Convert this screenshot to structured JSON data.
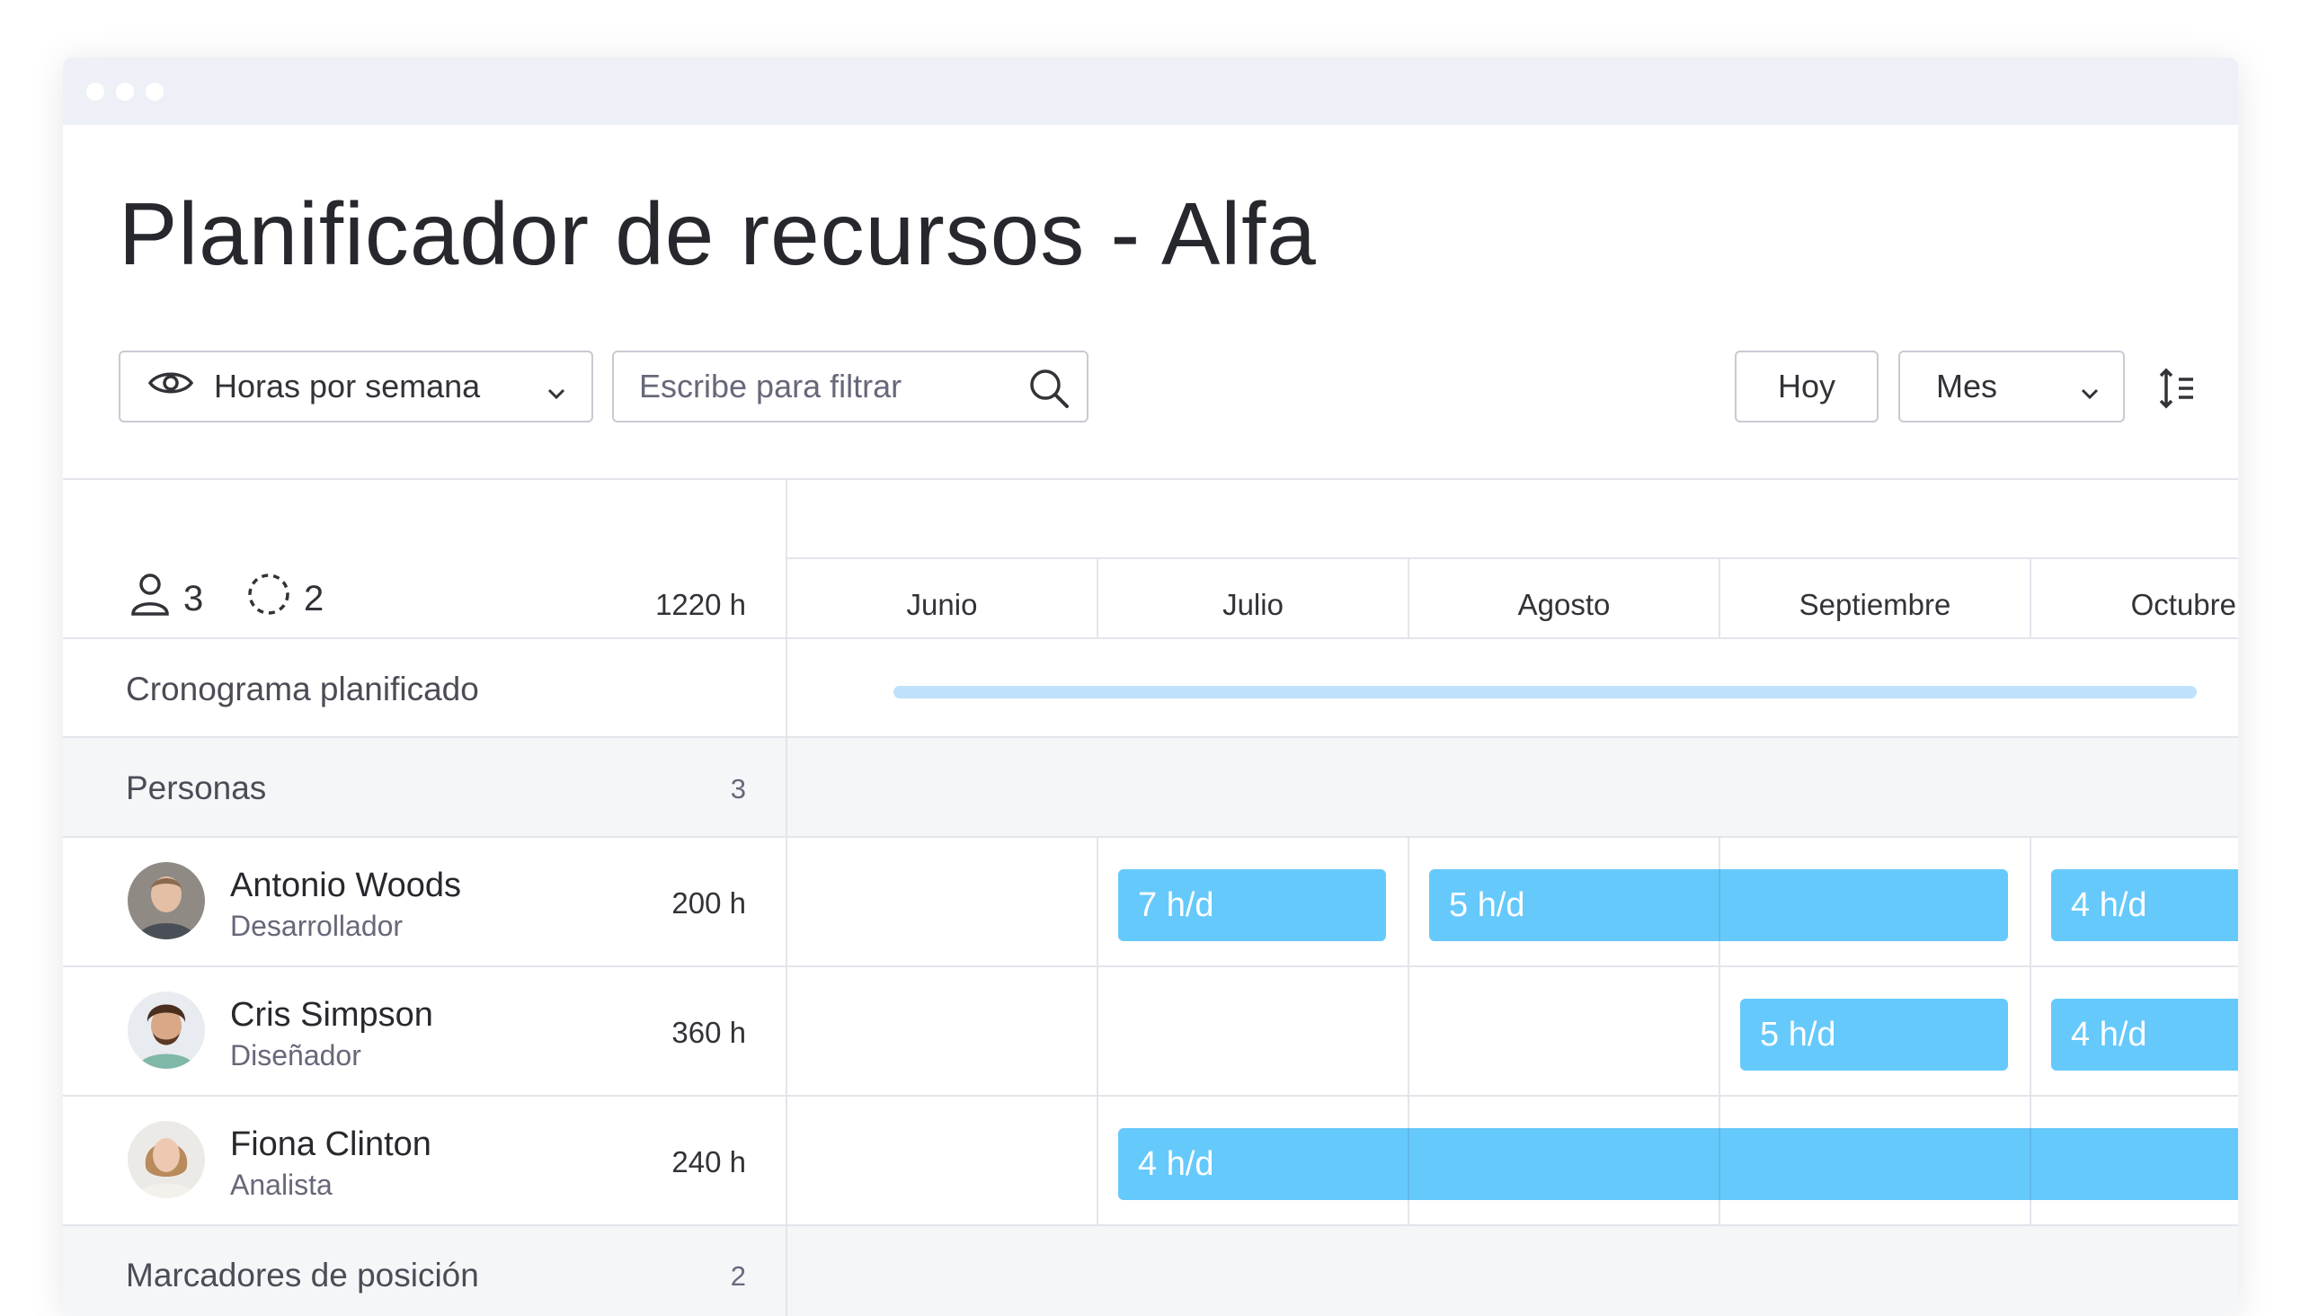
{
  "page": {
    "title": "Planificador de recursos - Alfa"
  },
  "toolbar": {
    "view_select": "Horas por semana",
    "filter_placeholder": "Escribe para filtrar",
    "today_label": "Hoy",
    "range_select": "Mes"
  },
  "summary": {
    "people_count": "3",
    "placeholder_count": "2",
    "total_hours": "1220 h"
  },
  "months": [
    "Junio",
    "Julio",
    "Agosto",
    "Septiembre",
    "Octubre"
  ],
  "schedule": {
    "label": "Cronograma planificado"
  },
  "sections": {
    "people": {
      "label": "Personas",
      "count": "3"
    },
    "placeholders": {
      "label": "Marcadores de posición",
      "count": "2"
    }
  },
  "people": [
    {
      "name": "Antonio Woods",
      "role": "Desarrollador",
      "hours": "200 h",
      "allocations": [
        "7 h/d",
        "5 h/d",
        "4 h/d"
      ]
    },
    {
      "name": "Cris Simpson",
      "role": "Diseñador",
      "hours": "360 h",
      "allocations": [
        "5 h/d",
        "4 h/d"
      ]
    },
    {
      "name": "Fiona Clinton",
      "role": "Analista",
      "hours": "240 h",
      "allocations": [
        "4 h/d"
      ]
    }
  ],
  "colors": {
    "allocation_bar": "#66c9fb",
    "timeline_bar": "#bfe1fb",
    "titlebar": "#edf0f7",
    "section_bg": "#f5f6f8"
  }
}
